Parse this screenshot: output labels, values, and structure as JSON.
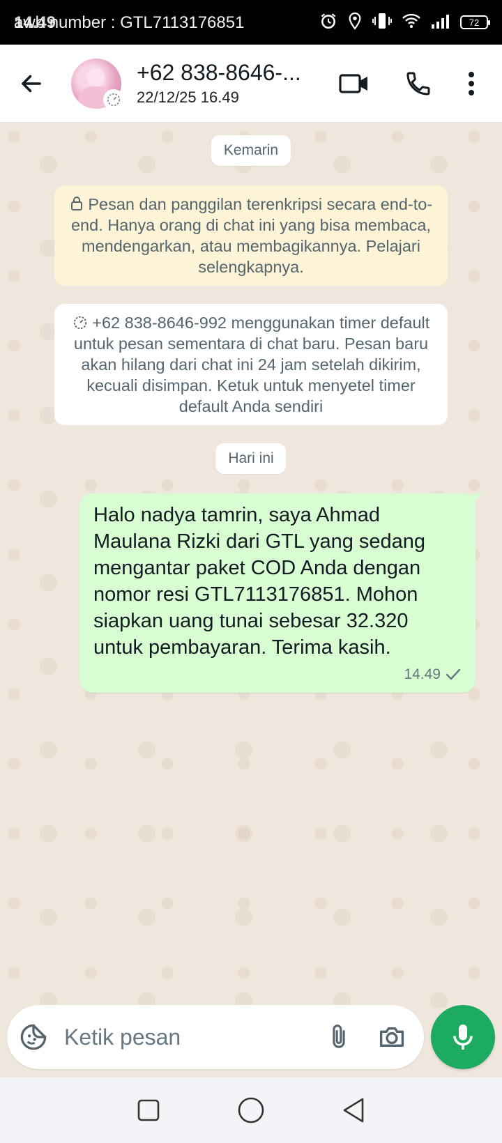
{
  "status_bar": {
    "time": "14.49",
    "notification_text": "awb number : GTL7113176851",
    "battery": "72"
  },
  "header": {
    "contact_name": "+62 838-8646-...",
    "last_seen": "22/12/25 16.49"
  },
  "chat": {
    "date_yesterday": "Kemarin",
    "encryption_notice": "Pesan dan panggilan terenkripsi secara end-to-end. Hanya orang di chat ini yang bisa membaca, mendengarkan, atau membagikannya. Pelajari selengkapnya.",
    "timer_notice": "+62 838-8646-992 menggunakan timer default untuk pesan sementara di chat baru. Pesan baru akan hilang dari chat ini 24 jam setelah dikirim, kecuali disimpan. Ketuk untuk menyetel timer default Anda sendiri",
    "date_today": "Hari ini",
    "messages": [
      {
        "text": "Halo nadya tamrin, saya Ahmad Maulana Rizki dari GTL yang sedang mengantar paket COD Anda dengan nomor resi GTL7113176851. Mohon siapkan uang tunai sebesar 32.320 untuk pembayaran. Terima kasih.",
        "time": "14.49",
        "status": "sent"
      }
    ]
  },
  "input": {
    "placeholder": "Ketik pesan"
  },
  "colors": {
    "accent_green": "#1daa61",
    "outgoing_bubble": "#d9fdd3",
    "encryption_bg": "#fdf3d6",
    "chat_bg": "#efe7dd"
  }
}
